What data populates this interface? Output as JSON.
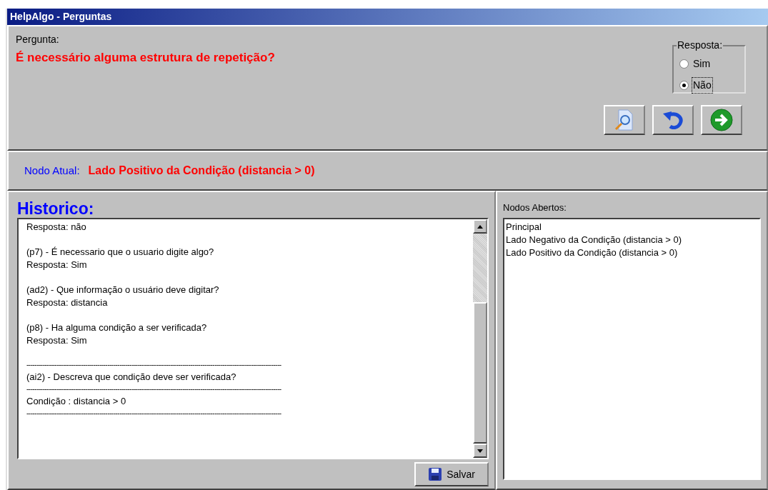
{
  "window": {
    "title": "HelpAlgo - Perguntas"
  },
  "question": {
    "label": "Pergunta:",
    "text": "É necessário alguma estrutura de repetição?"
  },
  "answer": {
    "legend": "Resposta:",
    "options": [
      {
        "label": "Sim",
        "selected": false
      },
      {
        "label": "Não",
        "selected": true
      }
    ]
  },
  "current_node": {
    "label": "Nodo Atual:",
    "value": "Lado Positivo da Condição (distancia > 0)"
  },
  "history": {
    "title": "Historico:",
    "entries": [
      {
        "kind": "block",
        "lines": [
          "Resposta: não"
        ]
      },
      {
        "kind": "block",
        "lines": [
          "(p7) - É necessario que o usuario digite algo?",
          "Resposta: Sim"
        ]
      },
      {
        "kind": "block",
        "lines": [
          "(ad2) - Que informação o usuário deve digitar?",
          "Resposta: distancia"
        ]
      },
      {
        "kind": "block",
        "lines": [
          "(p8) - Ha alguma condição a ser verificada?",
          "Resposta: Sim"
        ]
      },
      {
        "kind": "rule",
        "text": "------------------------------------------------------------------------------------------------------------------------------"
      },
      {
        "kind": "line",
        "text": "(ai2) - Descreva que condição deve ser verificada?"
      },
      {
        "kind": "rule",
        "text": "------------------------------------------------------------------------------------------------------------------------------"
      },
      {
        "kind": "line",
        "text": "Condição : distancia > 0"
      },
      {
        "kind": "rule",
        "text": "------------------------------------------------------------------------------------------------------------------------------"
      }
    ],
    "save_button": "Salvar"
  },
  "open_nodes": {
    "label": "Nodos Abertos:",
    "items": [
      "Principal",
      "Lado Negativo da Condição (distancia > 0)",
      "Lado Positivo da Condição (distancia > 0)"
    ]
  }
}
